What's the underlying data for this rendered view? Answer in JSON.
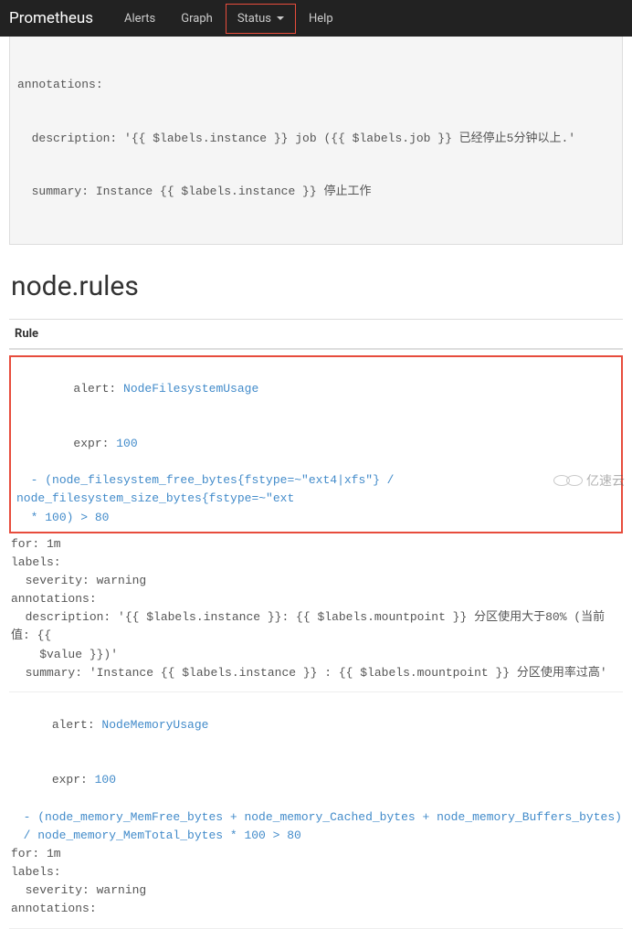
{
  "nav": {
    "brand": "Prometheus",
    "items": [
      "Alerts",
      "Graph",
      "Status",
      "Help"
    ]
  },
  "partial_rule_top": {
    "line1": "annotations:",
    "line2": "  description: '{{ $labels.instance }} job ({{ $labels.job }} 已经停止5分钟以上.'",
    "line3": "  summary: Instance {{ $labels.instance }} 停止工作"
  },
  "section_title": "node.rules",
  "rule_heading": "Rule",
  "rule1": {
    "alert_kw": "alert: ",
    "alert_name": "NodeFilesystemUsage",
    "expr_kw": "expr: ",
    "expr_val": "100",
    "expr_line": "  - (node_filesystem_free_bytes{fstype=~\"ext4|xfs\"} / node_filesystem_size_bytes{fstype=~\"ext",
    "expr_line2": "  * 100) > 80",
    "for_line": "for: 1m",
    "labels_line": "labels:",
    "sev_line": "  severity: warning",
    "ann_line": "annotations:",
    "desc_line": "  description: '{{ $labels.instance }}: {{ $labels.mountpoint }} 分区使用大于80% (当前值: {{",
    "desc_line2": "    $value }})'",
    "sum_line": "  summary: 'Instance {{ $labels.instance }} : {{ $labels.mountpoint }} 分区使用率过高'"
  },
  "rule2": {
    "alert_kw": "alert: ",
    "alert_name": "NodeMemoryUsage",
    "expr_kw": "expr: ",
    "expr_val": "100",
    "expr_line": "  - (node_memory_MemFree_bytes + node_memory_Cached_bytes + node_memory_Buffers_bytes)",
    "expr_line2": "  / node_memory_MemTotal_bytes * 100 > 80",
    "for_line": "for: 1m",
    "labels_line": "labels:",
    "sev_line": "  severity: warning",
    "ann_line": "annotations:"
  },
  "watermark": "亿速云"
}
